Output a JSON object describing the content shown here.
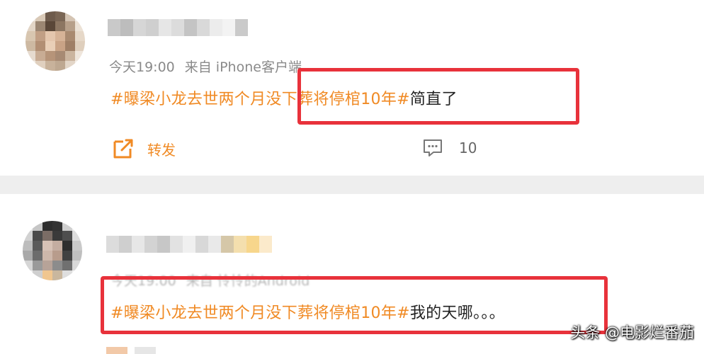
{
  "posts": [
    {
      "username": "",
      "time": "今天19:00",
      "source": "来自 iPhone客户端",
      "hashtag": "#曝梁小龙去世两个月没下葬将停棺10年#",
      "text": "简直了",
      "repost_label": "转发",
      "repost_icon": "share-square-icon",
      "comment_icon": "comment-bubble-icon",
      "comment_count": "10"
    },
    {
      "username": "",
      "time": "今天19:00",
      "source": "来自 怜怜的Android",
      "hashtag": "#曝梁小龙去世两个月没下葬将停棺10年#",
      "text": "我的天哪。。。"
    }
  ],
  "colors": {
    "accent": "#f08a24",
    "highlight": "#e8323b",
    "meta": "#8a8a8a"
  },
  "watermark": "头条 @电影烂番茄"
}
